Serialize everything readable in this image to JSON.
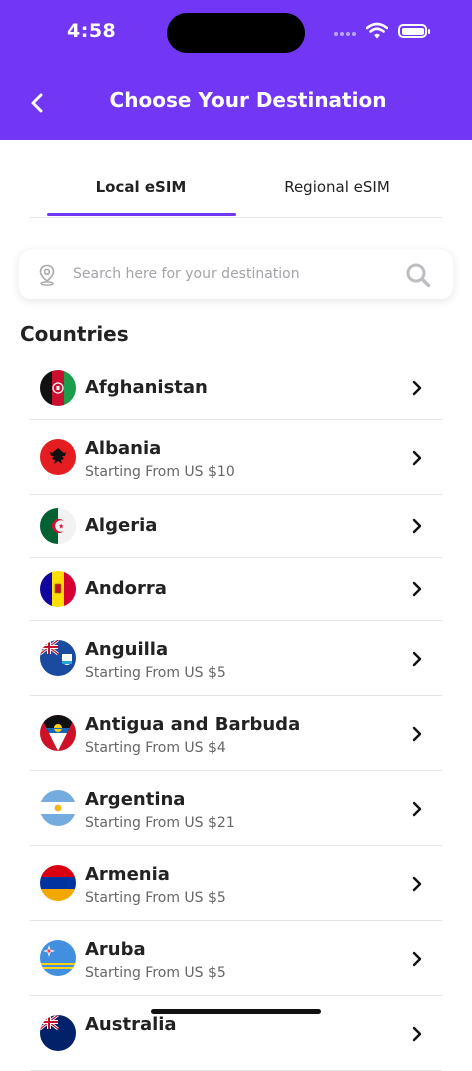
{
  "status_bar": {
    "time": "4:58"
  },
  "header": {
    "title": "Choose Your Destination"
  },
  "tabs": [
    {
      "label": "Local eSIM"
    },
    {
      "label": "Regional eSIM"
    }
  ],
  "search": {
    "placeholder": "Search here for your destination"
  },
  "section_title": "Countries",
  "countries": [
    {
      "name": "Afghanistan",
      "subtitle": ""
    },
    {
      "name": "Albania",
      "subtitle": "Starting From US $10"
    },
    {
      "name": "Algeria",
      "subtitle": ""
    },
    {
      "name": "Andorra",
      "subtitle": ""
    },
    {
      "name": "Anguilla",
      "subtitle": "Starting From US $5"
    },
    {
      "name": "Antigua and Barbuda",
      "subtitle": "Starting From US $4"
    },
    {
      "name": "Argentina",
      "subtitle": "Starting From US $21"
    },
    {
      "name": "Armenia",
      "subtitle": "Starting From US $5"
    },
    {
      "name": "Aruba",
      "subtitle": "Starting From US $5"
    },
    {
      "name": "Australia",
      "subtitle": ""
    }
  ],
  "colors": {
    "accent": "#7236f5"
  }
}
